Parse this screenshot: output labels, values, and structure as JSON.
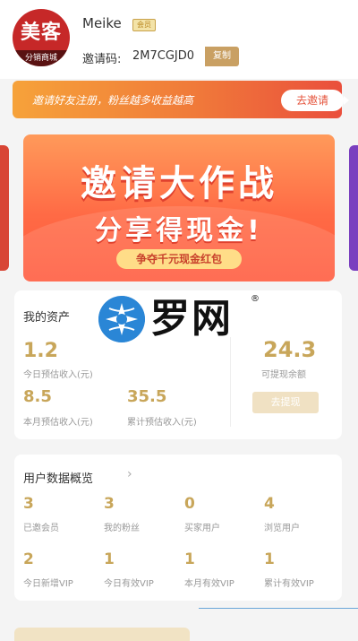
{
  "profile": {
    "avatar_logo": "美客",
    "avatar_sub": "分销商城",
    "nickname": "Meike",
    "level_badge": "会员",
    "invite_label": "邀请码:",
    "invite_code": "2M7CGJD0",
    "copy_label": "复制"
  },
  "invite_banner": {
    "text": "邀请好友注册，粉丝越多收益越高",
    "button_label": "去邀请"
  },
  "promo": {
    "title": "邀请大作战",
    "subtitle": "分享得现金!",
    "pill": "争夺千元现金红包"
  },
  "assets": {
    "title": "我的资产",
    "today_value": "1.2",
    "today_label": "今日预估收入(元)",
    "month_value": "8.5",
    "month_label": "本月预估收入(元)",
    "total_value": "35.5",
    "total_label": "累计预估收入(元)",
    "balance_value": "24.3",
    "balance_label": "可提现余额",
    "withdraw_label": "去提现"
  },
  "overview": {
    "title": "用户数据概览",
    "chevron": "›",
    "stats": [
      {
        "value": "3",
        "label": "已邀会员"
      },
      {
        "value": "3",
        "label": "我的粉丝"
      },
      {
        "value": "0",
        "label": "买家用户"
      },
      {
        "value": "4",
        "label": "浏览用户"
      },
      {
        "value": "2",
        "label": "今日新增VIP"
      },
      {
        "value": "1",
        "label": "今日有效VIP"
      },
      {
        "value": "1",
        "label": "本月有效VIP"
      },
      {
        "value": "1",
        "label": "累计有效VIP"
      }
    ]
  },
  "watermark": {
    "text": "罗网",
    "reg": "®",
    "icon": "globe-logo-icon"
  },
  "colors": {
    "gold": "#c8a65a",
    "banner_orange": "#f07a3a",
    "promo_red": "#ff6a45"
  }
}
